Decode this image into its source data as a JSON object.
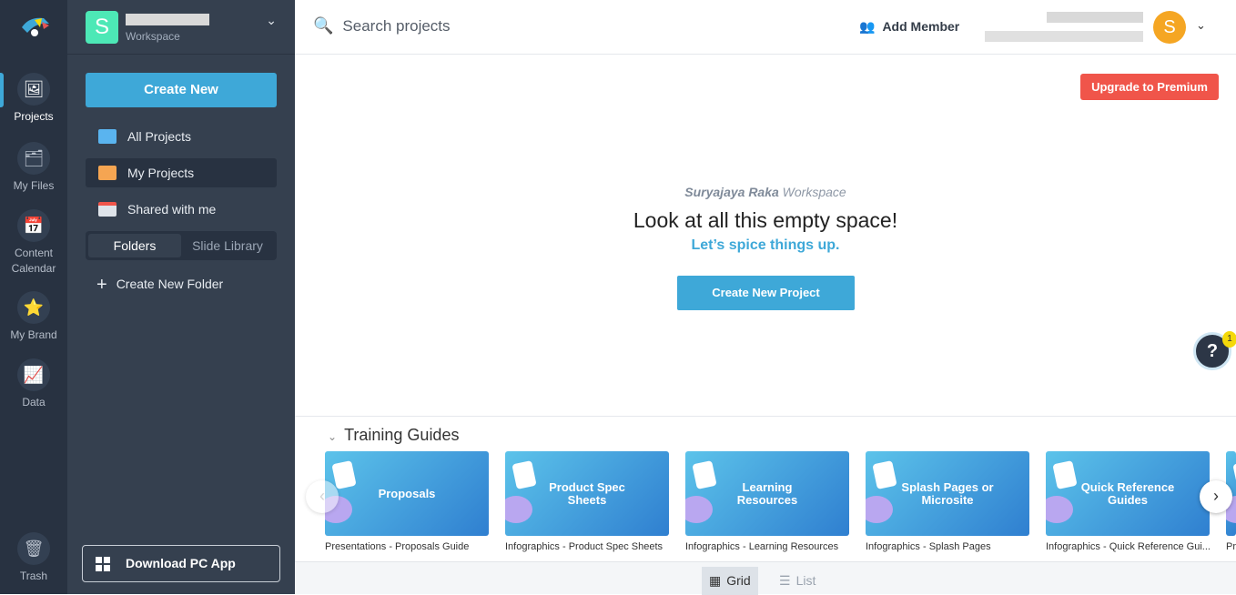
{
  "rail": {
    "items": [
      {
        "label": "Projects",
        "icon": "projects-icon"
      },
      {
        "label": "My Files",
        "icon": "files-icon"
      },
      {
        "label": "Content Calendar",
        "icon": "calendar-icon"
      },
      {
        "label": "My Brand",
        "icon": "brand-icon"
      },
      {
        "label": "Data",
        "icon": "data-icon"
      },
      {
        "label": "Trash",
        "icon": "trash-icon"
      }
    ]
  },
  "workspace": {
    "initial": "S",
    "subtitle": "Workspace"
  },
  "sidebar": {
    "create_new": "Create New",
    "nav": [
      {
        "label": "All Projects"
      },
      {
        "label": "My Projects"
      },
      {
        "label": "Shared with me"
      }
    ],
    "tabs": [
      "Folders",
      "Slide Library"
    ],
    "create_folder": "Create New Folder",
    "download": "Download PC App"
  },
  "topbar": {
    "search_placeholder": "Search projects",
    "add_member": "Add Member",
    "avatar_initial": "S"
  },
  "main": {
    "upgrade": "Upgrade to Premium",
    "workspace_name": "Suryajaya Raka",
    "workspace_suffix": " Workspace",
    "headline": "Look at all this empty space!",
    "subline": "Let’s spice things up.",
    "create_project": "Create New Project",
    "help": "?",
    "help_badge": "1"
  },
  "training": {
    "title": "Training Guides",
    "cards": [
      {
        "thumb": "Proposals",
        "caption": "Presentations - Proposals Guide"
      },
      {
        "thumb": "Product Spec Sheets",
        "caption": "Infographics - Product Spec Sheets"
      },
      {
        "thumb": "Learning Resources",
        "caption": "Infographics - Learning Resources"
      },
      {
        "thumb": "Splash Pages or Microsite",
        "caption": "Infographics - Splash Pages"
      },
      {
        "thumb": "Quick Reference Guides",
        "caption": "Infographics - Quick Reference Gui..."
      },
      {
        "thumb": "",
        "caption": "Pr"
      }
    ]
  },
  "view": {
    "grid": "Grid",
    "list": "List",
    "active": "Grid"
  },
  "colors": {
    "accent": "#3ea8d8",
    "upgrade": "#f0554a",
    "rail": "#283241",
    "sidebar": "#35404f"
  }
}
